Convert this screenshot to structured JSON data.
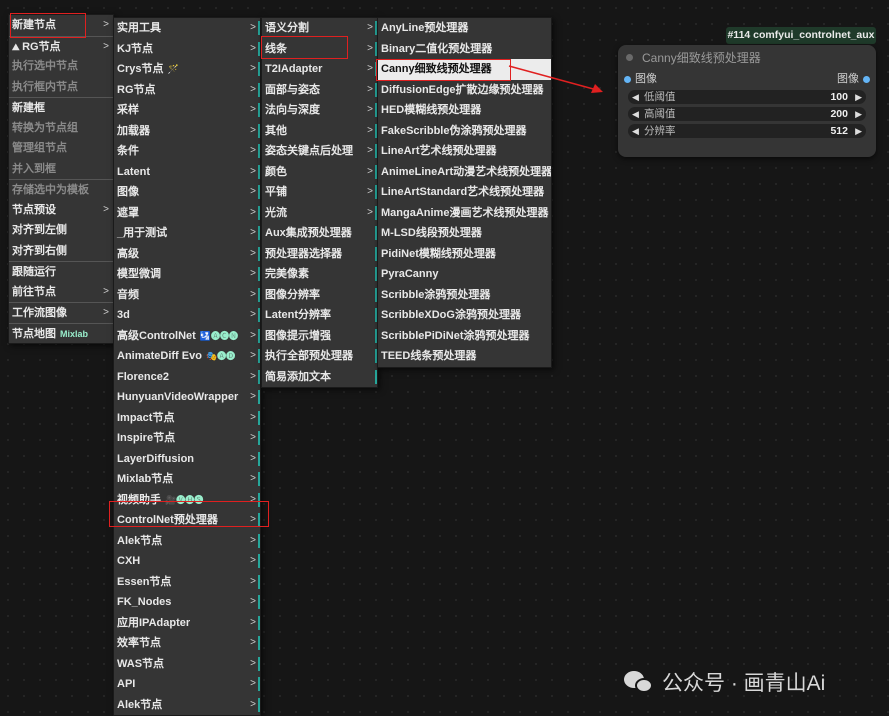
{
  "menu1": {
    "items": [
      {
        "label": "新建节点",
        "arrow": true,
        "highlight": false
      },
      {
        "label": "RG节点",
        "arrow": true,
        "icon": "rg-icon",
        "sep": true
      },
      {
        "label": "执行选中节点",
        "disabled": true
      },
      {
        "label": "执行框内节点",
        "disabled": true
      },
      {
        "label": "新建框",
        "sep": true
      },
      {
        "label": "转换为节点组",
        "disabled": true
      },
      {
        "label": "管理组节点",
        "disabled": true
      },
      {
        "label": "并入到框",
        "disabled": true
      },
      {
        "label": "存储选中为模板",
        "disabled": true,
        "sep": true
      },
      {
        "label": "节点预设",
        "arrow": true
      },
      {
        "label": "对齐到左侧"
      },
      {
        "label": "对齐到右侧"
      },
      {
        "label": "跟随运行",
        "sep": true
      },
      {
        "label": "前往节点",
        "arrow": true
      },
      {
        "label": "工作流图像",
        "arrow": true,
        "sep": true
      },
      {
        "label": "节点地图",
        "extra": "Mixlab",
        "sep": true
      }
    ]
  },
  "menu2": {
    "items": [
      {
        "label": "实用工具"
      },
      {
        "label": "KJ节点"
      },
      {
        "label": "Crys节点",
        "extra": "🪄"
      },
      {
        "label": "RG节点"
      },
      {
        "label": "采样"
      },
      {
        "label": "加载器"
      },
      {
        "label": "条件"
      },
      {
        "label": "Latent"
      },
      {
        "label": "图像"
      },
      {
        "label": "遮罩"
      },
      {
        "label": "_用于测试"
      },
      {
        "label": "高级"
      },
      {
        "label": "模型微调"
      },
      {
        "label": "音频"
      },
      {
        "label": "3d"
      },
      {
        "label": "高级ControlNet",
        "extra": "🛂🅐🅒🅝"
      },
      {
        "label": "AnimateDiff Evo",
        "extra": "🎭🅐🅓"
      },
      {
        "label": "Florence2"
      },
      {
        "label": "HunyuanVideoWrapper"
      },
      {
        "label": "Impact节点"
      },
      {
        "label": "Inspire节点"
      },
      {
        "label": "LayerDiffusion"
      },
      {
        "label": "Mixlab节点"
      },
      {
        "label": "视频助手",
        "extra": "🎥🅥🅗🅢"
      },
      {
        "label": "ControlNet预处理器"
      },
      {
        "label": "Alek节点"
      },
      {
        "label": "CXH"
      },
      {
        "label": "Essen节点"
      },
      {
        "label": "FK_Nodes"
      },
      {
        "label": "应用IPAdapter"
      },
      {
        "label": "效率节点"
      },
      {
        "label": "WAS节点"
      },
      {
        "label": "API"
      },
      {
        "label": "Alek节点"
      }
    ]
  },
  "menu3": {
    "items": [
      {
        "label": "语义分割",
        "arrow": true
      },
      {
        "label": "线条",
        "arrow": true
      },
      {
        "label": "T2IAdapter",
        "arrow": true
      },
      {
        "label": "面部与姿态",
        "arrow": true
      },
      {
        "label": "法向与深度",
        "arrow": true
      },
      {
        "label": "其他",
        "arrow": true
      },
      {
        "label": "姿态关键点后处理",
        "arrow": true
      },
      {
        "label": "颜色",
        "arrow": true
      },
      {
        "label": "平铺",
        "arrow": true
      },
      {
        "label": "光流",
        "arrow": true
      },
      {
        "label": "Aux集成预处理器"
      },
      {
        "label": "预处理器选择器"
      },
      {
        "label": "完美像素"
      },
      {
        "label": "图像分辨率"
      },
      {
        "label": "Latent分辨率"
      },
      {
        "label": "图像提示增强"
      },
      {
        "label": "执行全部预处理器"
      },
      {
        "label": "简易添加文本"
      }
    ]
  },
  "menu4": {
    "items": [
      {
        "label": "AnyLine预处理器"
      },
      {
        "label": "Binary二值化预处理器"
      },
      {
        "label": "Canny细致线预处理器",
        "highlight": true
      },
      {
        "label": "DiffusionEdge扩散边缘预处理器"
      },
      {
        "label": "HED模糊线预处理器"
      },
      {
        "label": "FakeScribble伪涂鸦预处理器"
      },
      {
        "label": "LineArt艺术线预处理器"
      },
      {
        "label": "AnimeLineArt动漫艺术线预处理器"
      },
      {
        "label": "LineArtStandard艺术线预处理器"
      },
      {
        "label": "MangaAnime漫画艺术线预处理器"
      },
      {
        "label": "M-LSD线段预处理器"
      },
      {
        "label": "PidiNet模糊线预处理器"
      },
      {
        "label": "PyraCanny"
      },
      {
        "label": "Scribble涂鸦预处理器"
      },
      {
        "label": "ScribbleXDoG涂鸦预处理器"
      },
      {
        "label": "ScribblePiDiNet涂鸦预处理器"
      },
      {
        "label": "TEED线条预处理器"
      }
    ]
  },
  "node": {
    "badge": "#114 comfyui_controlnet_aux",
    "title": "Canny细致线预处理器",
    "input_label": "图像",
    "output_label": "图像",
    "widgets": [
      {
        "name": "低阈值",
        "value": "100"
      },
      {
        "name": "高阈值",
        "value": "200"
      },
      {
        "name": "分辨率",
        "value": "512"
      }
    ]
  },
  "watermark": {
    "text": "公众号 · 画青山Ai"
  },
  "colors": {
    "highlight_box": "#e02020",
    "accent_tick": "#26a69a",
    "port": "#64b5f6",
    "arrow": "#e02020"
  }
}
